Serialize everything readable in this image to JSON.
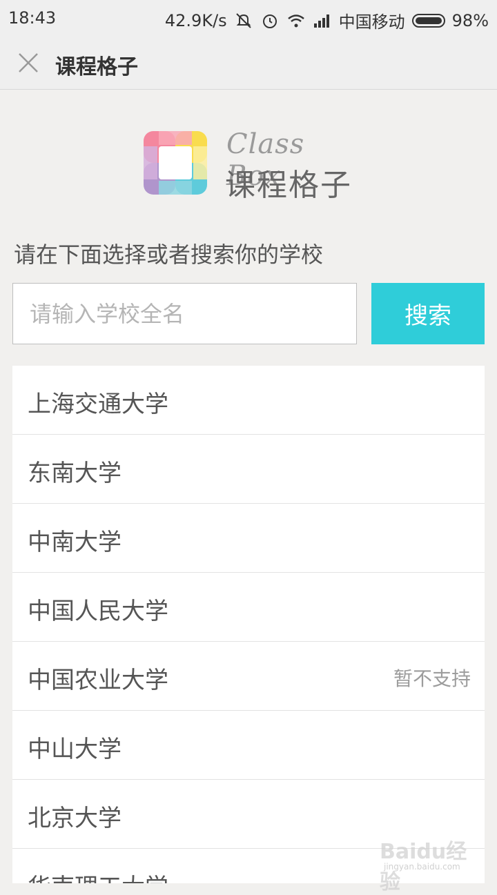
{
  "status_bar": {
    "time": "18:43",
    "network_speed": "42.9K/s",
    "carrier": "中国移动",
    "battery": "98%",
    "icons": [
      "mute-icon",
      "alarm-icon",
      "wifi-icon",
      "signal-icon",
      "battery-icon"
    ]
  },
  "header": {
    "title": "课程格子",
    "close_icon": "close-icon"
  },
  "logo": {
    "english": "Class Box",
    "chinese": "课程格子"
  },
  "prompt": "请在下面选择或者搜索你的学校",
  "search": {
    "placeholder": "请输入学校全名",
    "value": "",
    "button_label": "搜索",
    "button_color": "#2fcdd9"
  },
  "schools": [
    {
      "name": "上海交通大学",
      "status": ""
    },
    {
      "name": "东南大学",
      "status": ""
    },
    {
      "name": "中南大学",
      "status": ""
    },
    {
      "name": "中国人民大学",
      "status": ""
    },
    {
      "name": "中国农业大学",
      "status": "暂不支持"
    },
    {
      "name": "中山大学",
      "status": ""
    },
    {
      "name": "北京大学",
      "status": ""
    },
    {
      "name": "华南理工大学",
      "status": ""
    }
  ],
  "watermark": {
    "main": "Baidu经验",
    "sub": "jingyan.baidu.com"
  }
}
